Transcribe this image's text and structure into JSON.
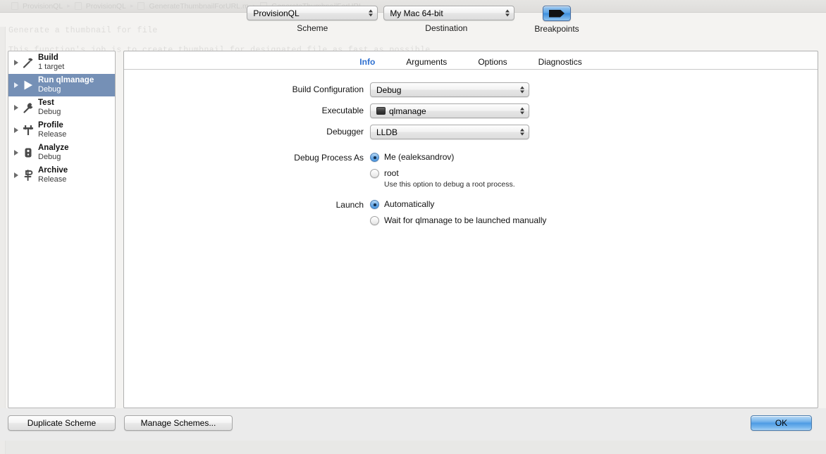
{
  "background": {
    "breadcrumb": [
      "ProvisionQL",
      "ProvisionQL",
      "GenerateThumbnailForURL.m",
      "GenerateThumbnailForURL"
    ],
    "code_lines": [
      "Generate a thumbnail for file",
      "This function's job is to create thumbnail for designated file as fast as possible"
    ]
  },
  "toolbar": {
    "scheme": {
      "value": "ProvisionQL",
      "label": "Scheme"
    },
    "destination": {
      "value": "My Mac 64-bit",
      "label": "Destination"
    },
    "breakpoints": {
      "label": "Breakpoints",
      "icon": "breakpoint-arrow-icon",
      "enabled": true
    }
  },
  "sidebar": {
    "items": [
      {
        "title": "Build",
        "subtitle": "1 target",
        "icon": "hammer-icon",
        "selected": false
      },
      {
        "title": "Run qlmanage",
        "subtitle": "Debug",
        "icon": "play-icon",
        "selected": true
      },
      {
        "title": "Test",
        "subtitle": "Debug",
        "icon": "wrench-icon",
        "selected": false
      },
      {
        "title": "Profile",
        "subtitle": "Release",
        "icon": "gauge-icon",
        "selected": false
      },
      {
        "title": "Analyze",
        "subtitle": "Debug",
        "icon": "stethoscope-icon",
        "selected": false
      },
      {
        "title": "Archive",
        "subtitle": "Release",
        "icon": "archive-icon",
        "selected": false
      }
    ]
  },
  "panel": {
    "tabs": [
      {
        "label": "Info",
        "active": true
      },
      {
        "label": "Arguments",
        "active": false
      },
      {
        "label": "Options",
        "active": false
      },
      {
        "label": "Diagnostics",
        "active": false
      }
    ],
    "fields": {
      "build_configuration": {
        "label": "Build Configuration",
        "value": "Debug"
      },
      "executable": {
        "label": "Executable",
        "value": "qlmanage",
        "icon": "executable-icon"
      },
      "debugger": {
        "label": "Debugger",
        "value": "LLDB"
      }
    },
    "debug_process_as": {
      "label": "Debug Process As",
      "options": [
        {
          "text": "Me (ealeksandrov)",
          "selected": true,
          "hint": ""
        },
        {
          "text": "root",
          "selected": false,
          "hint": "Use this option to debug a root process."
        }
      ]
    },
    "launch": {
      "label": "Launch",
      "options": [
        {
          "text": "Automatically",
          "selected": true
        },
        {
          "text": "Wait for qlmanage to be launched manually",
          "selected": false
        }
      ]
    }
  },
  "bottom": {
    "duplicate_scheme": "Duplicate Scheme",
    "manage_schemes": "Manage Schemes...",
    "ok": "OK"
  },
  "colors": {
    "accent_blue": "#2d6fd0",
    "selection_blue": "#7590b6",
    "default_button_blue": "#4e9be4"
  }
}
